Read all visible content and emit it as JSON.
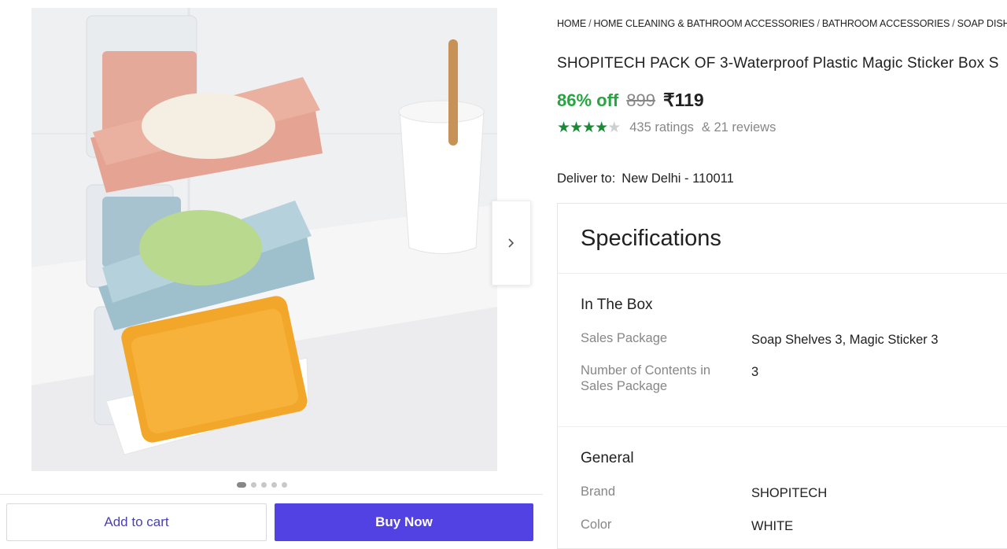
{
  "gallery": {
    "dots_count": 5,
    "active_dot": 0,
    "next_icon": "chevron-right-icon"
  },
  "actions": {
    "add_to_cart": "Add to cart",
    "buy_now": "Buy Now"
  },
  "breadcrumb": [
    "HOME",
    "HOME CLEANING & BATHROOM ACCESSORIES",
    "BATHROOM ACCESSORIES",
    "SOAP DISHE"
  ],
  "product": {
    "title": "SHOPITECH PACK OF 3-Waterproof Plastic Magic Sticker Box S",
    "discount": "86% off",
    "mrp": "899",
    "price": "₹119",
    "rating_stars": 4,
    "ratings": "435 ratings",
    "reviews": "& 21 reviews"
  },
  "delivery": {
    "label": "Deliver to:",
    "location": "New Delhi - 110011"
  },
  "specifications": {
    "heading": "Specifications",
    "sections": [
      {
        "title": "In The Box",
        "rows": [
          {
            "key": "Sales Package",
            "value": "Soap Shelves 3, Magic Sticker 3"
          },
          {
            "key": "Number of Contents in Sales Package",
            "value": "3"
          }
        ]
      },
      {
        "title": "General",
        "rows": [
          {
            "key": "Brand",
            "value": "SHOPITECH"
          },
          {
            "key": "Color",
            "value": "WHITE"
          }
        ]
      }
    ]
  },
  "colors": {
    "discount_green": "#26a541",
    "star_green": "#1a8a35",
    "buy_button": "#5241e3",
    "cart_text": "#4b3fb5"
  }
}
